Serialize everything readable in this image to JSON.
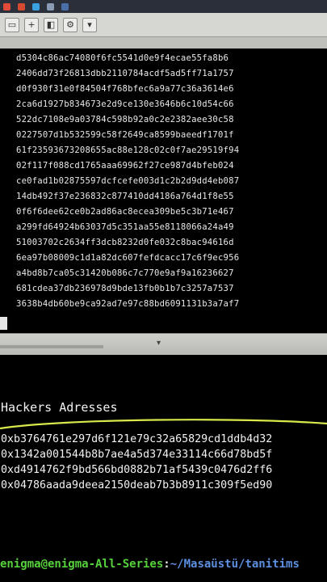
{
  "taskbar": {
    "items": [
      {
        "icon": "app-icon",
        "label": "",
        "color": "#e04b3a"
      },
      {
        "icon": "browser-icon",
        "label": "",
        "color": "#d64a31"
      },
      {
        "icon": "media-icon",
        "label": "",
        "color": "#3aa0e0"
      },
      {
        "icon": "folder-icon",
        "label": "",
        "color": "#8a9bb3"
      },
      {
        "icon": "terminal-icon",
        "label": "",
        "color": "#4a6ea8"
      }
    ]
  },
  "hex_dump": [
    "d5304c86ac74080f6fc5541d0e9f4ecae55fa8b6",
    "2406dd73f26813dbb2110784acdf5ad5ff71a1757",
    "d0f930f31e0f84504f768bfec6a9a77c36a3614e6",
    "2ca6d1927b834673e2d9ce130e3646b6c10d54c66",
    "522dc7108e9a03784c598b92a0c2e2382aee30c58",
    "0227507d1b532599c58f2649ca8599baeedf1701f",
    "61f23593673208655ac88e128c02c0f7ae29519f94",
    "02f117f088cd1765aaa69962f27ce987d4bfeb024",
    "ce0fad1b02875597dcfcefe003d1c2b2d9dd4eb087",
    "14db492f37e236832c877410dd4186a764d1f8e55",
    "0f6f6dee62ce0b2ad86ac8ecea309be5c3b71e467",
    "a299fd64924b63037d5c351aa55e8118066a24a49",
    "51003702c2634ff3dcb8232d0fe032c8bac94616d",
    "6ea97b08009c1d1a82dc607fefdcacc17c6f9ec956",
    "a4bd8b7ca05c31420b086c7c770e9af9a16236627",
    "681cdea37db236978d9bde13fb0b1b7c3257a7537",
    "3638b4db60be9ca92ad7e97c88bd6091131b3a7af7"
  ],
  "hackers": {
    "heading": "Hackers Adresses",
    "addresses": [
      "0xb3764761e297d6f121e79c32a65829cd1ddb4d32",
      "0x1342a001544b8b7ae4a5d374e33114c66d78bd5f",
      "0xd4914762f9bd566bd0882b71af5439c0476d2ff6",
      "0x04786aada9deea2150deab7b3b8911c309f5ed90"
    ]
  },
  "prompt": {
    "user_host": "enigma@enigma-All-Series",
    "separator": ":",
    "path": "~/Masaüstü/tanitims"
  },
  "colors": {
    "prompt_user": "#56d13b",
    "prompt_path": "#5c8fe0",
    "highlight_curve": "#d9e84a"
  }
}
